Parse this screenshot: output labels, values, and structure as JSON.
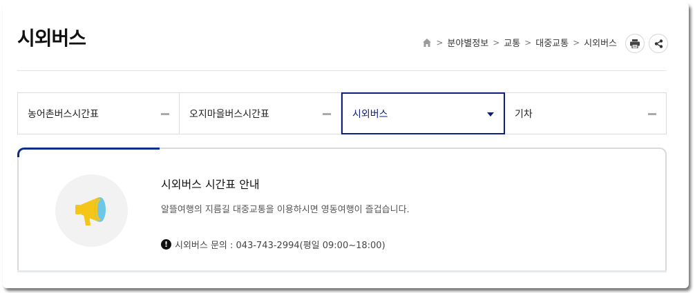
{
  "page": {
    "title": "시외버스"
  },
  "breadcrumb": {
    "items": [
      "분야별정보",
      "교통",
      "대중교통",
      "시외버스"
    ],
    "separator": ">"
  },
  "tools": {
    "print_icon": "print-icon",
    "share_icon": "share-icon"
  },
  "tabs": [
    {
      "label": "농어촌버스시간표",
      "state": "collapsed"
    },
    {
      "label": "오지마을버스시간표",
      "state": "collapsed"
    },
    {
      "label": "시외버스",
      "state": "active"
    },
    {
      "label": "기차",
      "state": "collapsed"
    }
  ],
  "info": {
    "title": "시외버스 시간표 안내",
    "description": "알뜰여행의 지름길 대중교통을 이용하시면 영동여행이 즐겁습니다.",
    "contact": "시외버스 문의 : 043-743-2994(평일 09:00~18:00)",
    "alert_symbol": "!",
    "icon": "megaphone-icon"
  },
  "colors": {
    "accent": "#0a1e7a",
    "megaphone_yellow": "#f5c518",
    "megaphone_blue": "#6fc7e8"
  }
}
